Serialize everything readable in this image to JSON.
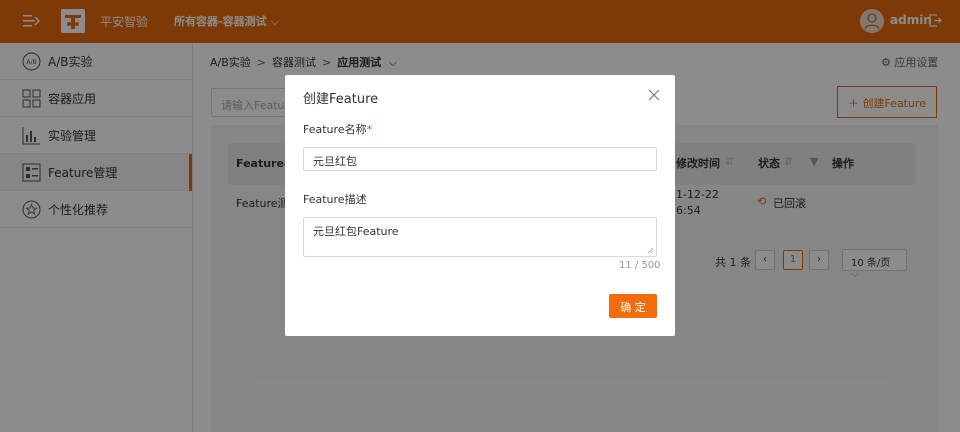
{
  "topbar": {
    "brand": "平安智验",
    "scope": "所有容器-容器测试",
    "user": "admin"
  },
  "sidebar": {
    "items": [
      {
        "label": "A/B实验",
        "icon": "ab-test-icon"
      },
      {
        "label": "容器应用",
        "icon": "grid-apps-icon"
      },
      {
        "label": "实验管理",
        "icon": "chart-icon"
      },
      {
        "label": "Feature管理",
        "icon": "feature-list-icon",
        "active": true
      },
      {
        "label": "个性化推荐",
        "icon": "star-badge-icon"
      }
    ]
  },
  "breadcrumb": {
    "items": [
      "A/B实验",
      "容器测试",
      "应用测试"
    ],
    "separator": ">"
  },
  "toolbar": {
    "app_settings": "应用设置",
    "search_placeholder": "请输入Feature",
    "create_label": "创建Feature"
  },
  "table": {
    "headers": [
      "Feature名",
      "修改时间",
      "状态",
      "操作"
    ],
    "rows": [
      {
        "name": "Feature测",
        "time_line1": "1-12-22",
        "time_line2": "6:54",
        "status": "已回滚"
      }
    ]
  },
  "pagination": {
    "total": "共 1 条",
    "current": "1",
    "page_size": "10 条/页"
  },
  "modal": {
    "title": "创建Feature",
    "name_label": "Feature名称",
    "name_required": "*",
    "name_value": "元旦红包",
    "desc_label": "Feature描述",
    "desc_value": "元旦红包Feature",
    "counter": "11 / 500",
    "ok_label": "确 定"
  },
  "colors": {
    "brand": "#e56a0c",
    "primary_button": "#f26b0c"
  }
}
